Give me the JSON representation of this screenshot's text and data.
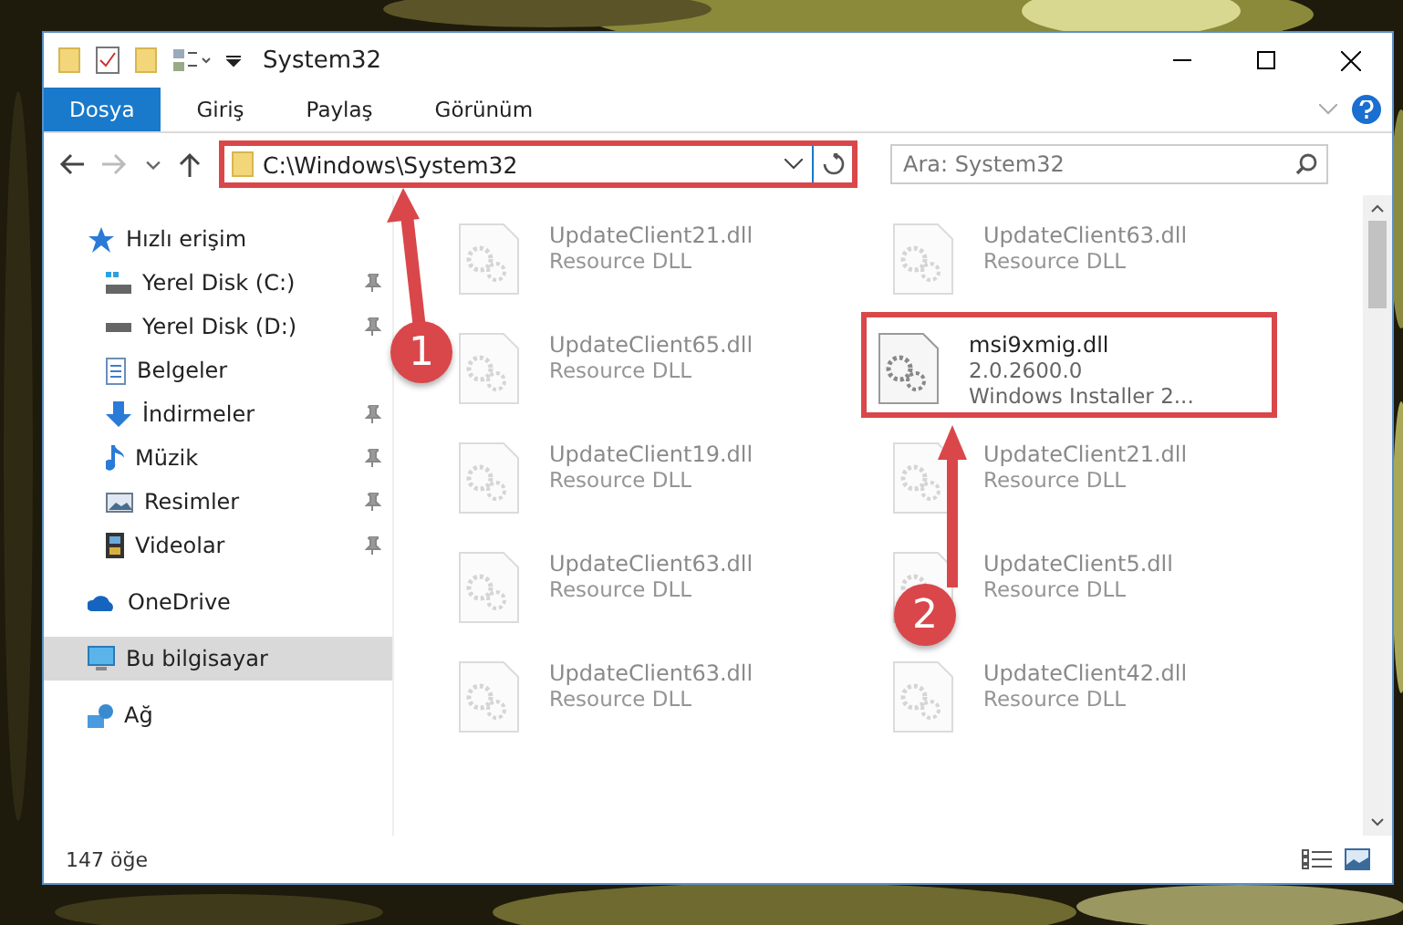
{
  "window": {
    "title": "System32"
  },
  "ribbon_tabs": [
    {
      "label": "Dosya",
      "selected": true
    },
    {
      "label": "Giriş",
      "selected": false
    },
    {
      "label": "Paylaş",
      "selected": false
    },
    {
      "label": "Görünüm",
      "selected": false
    }
  ],
  "address": {
    "path": "C:\\Windows\\System32",
    "highlighted": true
  },
  "search": {
    "placeholder": "Ara: System32"
  },
  "sidebar": {
    "items": [
      {
        "label": "Hızlı erişim",
        "kind": "star",
        "selected": false,
        "children": [
          {
            "label": "Yerel Disk (C:)",
            "kind": "drive-c",
            "pinned": true,
            "selected": false
          },
          {
            "label": "Yerel Disk (D:)",
            "kind": "drive",
            "pinned": true,
            "selected": false
          },
          {
            "label": "Belgeler",
            "kind": "docs",
            "pinned": false,
            "selected": false
          },
          {
            "label": "İndirmeler",
            "kind": "download",
            "pinned": true,
            "selected": false
          },
          {
            "label": "Müzik",
            "kind": "music",
            "pinned": true,
            "selected": false
          },
          {
            "label": "Resimler",
            "kind": "pictures",
            "pinned": true,
            "selected": false
          },
          {
            "label": "Videolar",
            "kind": "video",
            "pinned": true,
            "selected": false
          }
        ]
      },
      {
        "label": "OneDrive",
        "kind": "cloud",
        "selected": false
      },
      {
        "label": "Bu bilgisayar",
        "kind": "pc",
        "selected": true
      },
      {
        "label": "Ağ",
        "kind": "network",
        "selected": false
      }
    ]
  },
  "files": [
    {
      "name": "UpdateClient21.dll",
      "detail": "Resource DLL",
      "dimmed": true,
      "highlighted": false
    },
    {
      "name": "UpdateClient63.dll",
      "detail": "Resource DLL",
      "dimmed": true,
      "highlighted": false
    },
    {
      "name": "UpdateClient65.dll",
      "detail": "Resource DLL",
      "dimmed": true,
      "highlighted": false
    },
    {
      "name": "msi9xmig.dll",
      "version": "2.0.2600.0",
      "detail": "Windows Installer 2...",
      "dimmed": false,
      "highlighted": true
    },
    {
      "name": "UpdateClient19.dll",
      "detail": "Resource DLL",
      "dimmed": true,
      "highlighted": false
    },
    {
      "name": "UpdateClient21.dll",
      "detail": "Resource DLL",
      "dimmed": true,
      "highlighted": false
    },
    {
      "name": "UpdateClient63.dll",
      "detail": "Resource DLL",
      "dimmed": true,
      "highlighted": false
    },
    {
      "name": "UpdateClient5.dll",
      "detail": "Resource DLL",
      "dimmed": true,
      "highlighted": false
    },
    {
      "name": "UpdateClient63.dll",
      "detail": "Resource DLL",
      "dimmed": true,
      "highlighted": false
    },
    {
      "name": "UpdateClient42.dll",
      "detail": "Resource DLL",
      "dimmed": true,
      "highlighted": false
    }
  ],
  "status_bar": {
    "count": "147 öğe"
  },
  "step_markers": [
    {
      "label": "1"
    },
    {
      "label": "2"
    }
  ]
}
